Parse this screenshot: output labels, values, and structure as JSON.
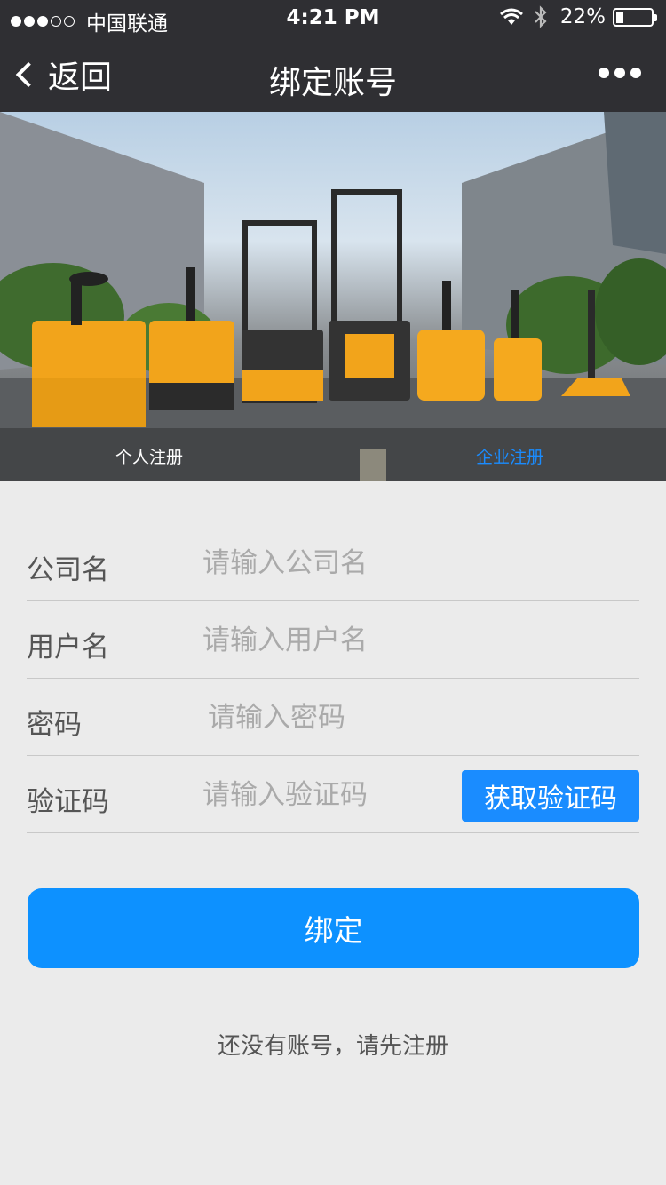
{
  "status_bar": {
    "carrier": "中国联通",
    "time": "4:21 PM",
    "battery": "22%",
    "battery_level": 0.22,
    "signal_bars_filled": 3,
    "signal_bars_total": 5
  },
  "nav": {
    "back_label": "返回",
    "title": "绑定账号",
    "more_icon": "more-dots-icon"
  },
  "banner": {
    "tabs": [
      {
        "label": "个人注册",
        "active": false
      },
      {
        "label": "企业注册",
        "active": true
      }
    ]
  },
  "form": {
    "fields": [
      {
        "label": "公司名",
        "placeholder": "请输入公司名",
        "value": ""
      },
      {
        "label": "用户名",
        "placeholder": "请输入用户名",
        "value": ""
      },
      {
        "label": "密码",
        "placeholder": "请输入密码",
        "value": ""
      },
      {
        "label": "验证码",
        "placeholder": "请输入验证码",
        "value": ""
      }
    ],
    "get_code_label": "获取验证码",
    "submit_label": "绑定",
    "register_link": "还没有账号，请先注册"
  },
  "colors": {
    "accent": "#1a8cff",
    "bar_bg": "#2f2f33",
    "page_bg": "#ebebeb"
  }
}
